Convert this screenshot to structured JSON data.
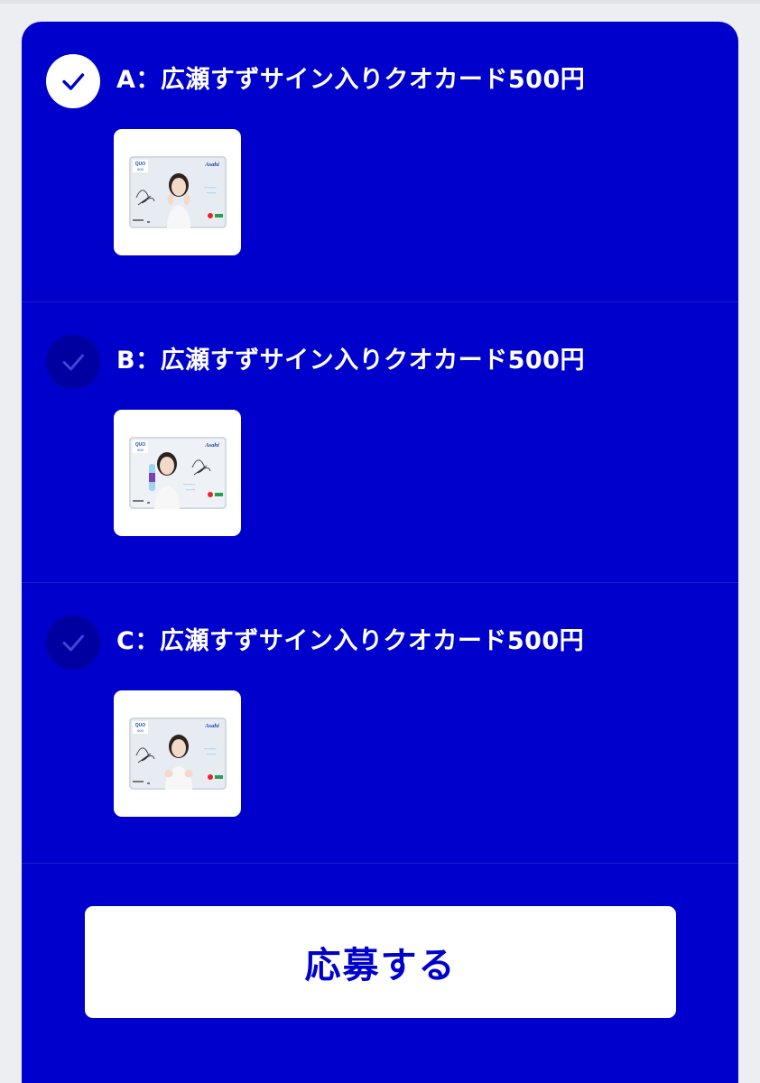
{
  "colors": {
    "panel": "#0000cc",
    "text_on_panel": "#ffffff",
    "button_bg": "#ffffff",
    "button_text": "#0000cc"
  },
  "options": [
    {
      "title": "A：広瀬すずサイン入りクオカード500円",
      "selected": true,
      "image": "quo-card-a-image",
      "card_brand": "QUO",
      "card_value": "500",
      "card_sponsor": "Asahi"
    },
    {
      "title": "B：広瀬すずサイン入りクオカード500円",
      "selected": false,
      "image": "quo-card-b-image",
      "card_brand": "QUO",
      "card_value": "500",
      "card_sponsor": "Asahi"
    },
    {
      "title": "C：広瀬すずサイン入りクオカード500円",
      "selected": false,
      "image": "quo-card-c-image",
      "card_brand": "QUO",
      "card_value": "500",
      "card_sponsor": "Asahi"
    }
  ],
  "submit": {
    "label": "応募する"
  }
}
